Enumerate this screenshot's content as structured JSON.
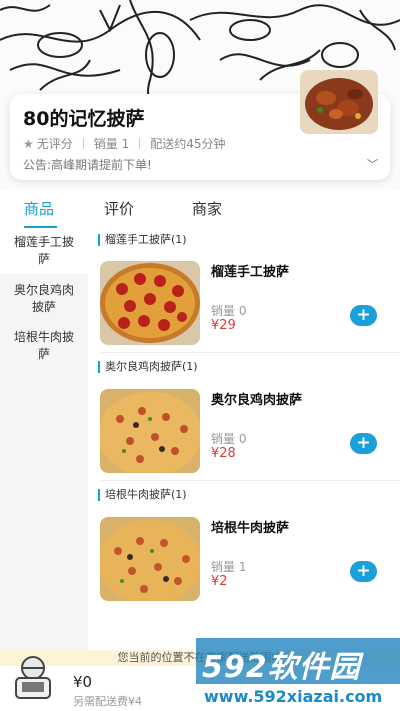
{
  "shop": {
    "name": "80的记忆披萨",
    "rating": "无评分",
    "sales": "销量 1",
    "delivery": "配送约45分钟",
    "notice": "公告:高峰期请提前下单!"
  },
  "tabs": [
    {
      "label": "商品",
      "active": true
    },
    {
      "label": "评价",
      "active": false
    },
    {
      "label": "商家",
      "active": false
    }
  ],
  "categories": [
    {
      "label": "榴莲手工披萨",
      "active": true
    },
    {
      "label": "奥尔良鸡肉披萨",
      "active": false
    },
    {
      "label": "培根牛肉披萨",
      "active": false
    }
  ],
  "sections": [
    {
      "header": "榴莲手工披萨(1)",
      "item": {
        "name": "榴莲手工披萨",
        "sales": "销量 0",
        "price": "¥29"
      }
    },
    {
      "header": "奥尔良鸡肉披萨(1)",
      "item": {
        "name": "奥尔良鸡肉披萨",
        "sales": "销量 0",
        "price": "¥28"
      }
    },
    {
      "header": "培根牛肉披萨(1)",
      "item": {
        "name": "培根牛肉披萨",
        "sales": "销量 1",
        "price": "¥2"
      }
    }
  ],
  "bottom": {
    "location_notice": "您当前的位置不在商家配送范围内",
    "cart_total": "¥0",
    "delivery_fee": "另需配送费¥4"
  },
  "watermark": {
    "logo": "592软件园",
    "url": "www.592xiazai.com"
  },
  "colors": {
    "accent": "#1aa0c8",
    "price": "#e53935"
  }
}
